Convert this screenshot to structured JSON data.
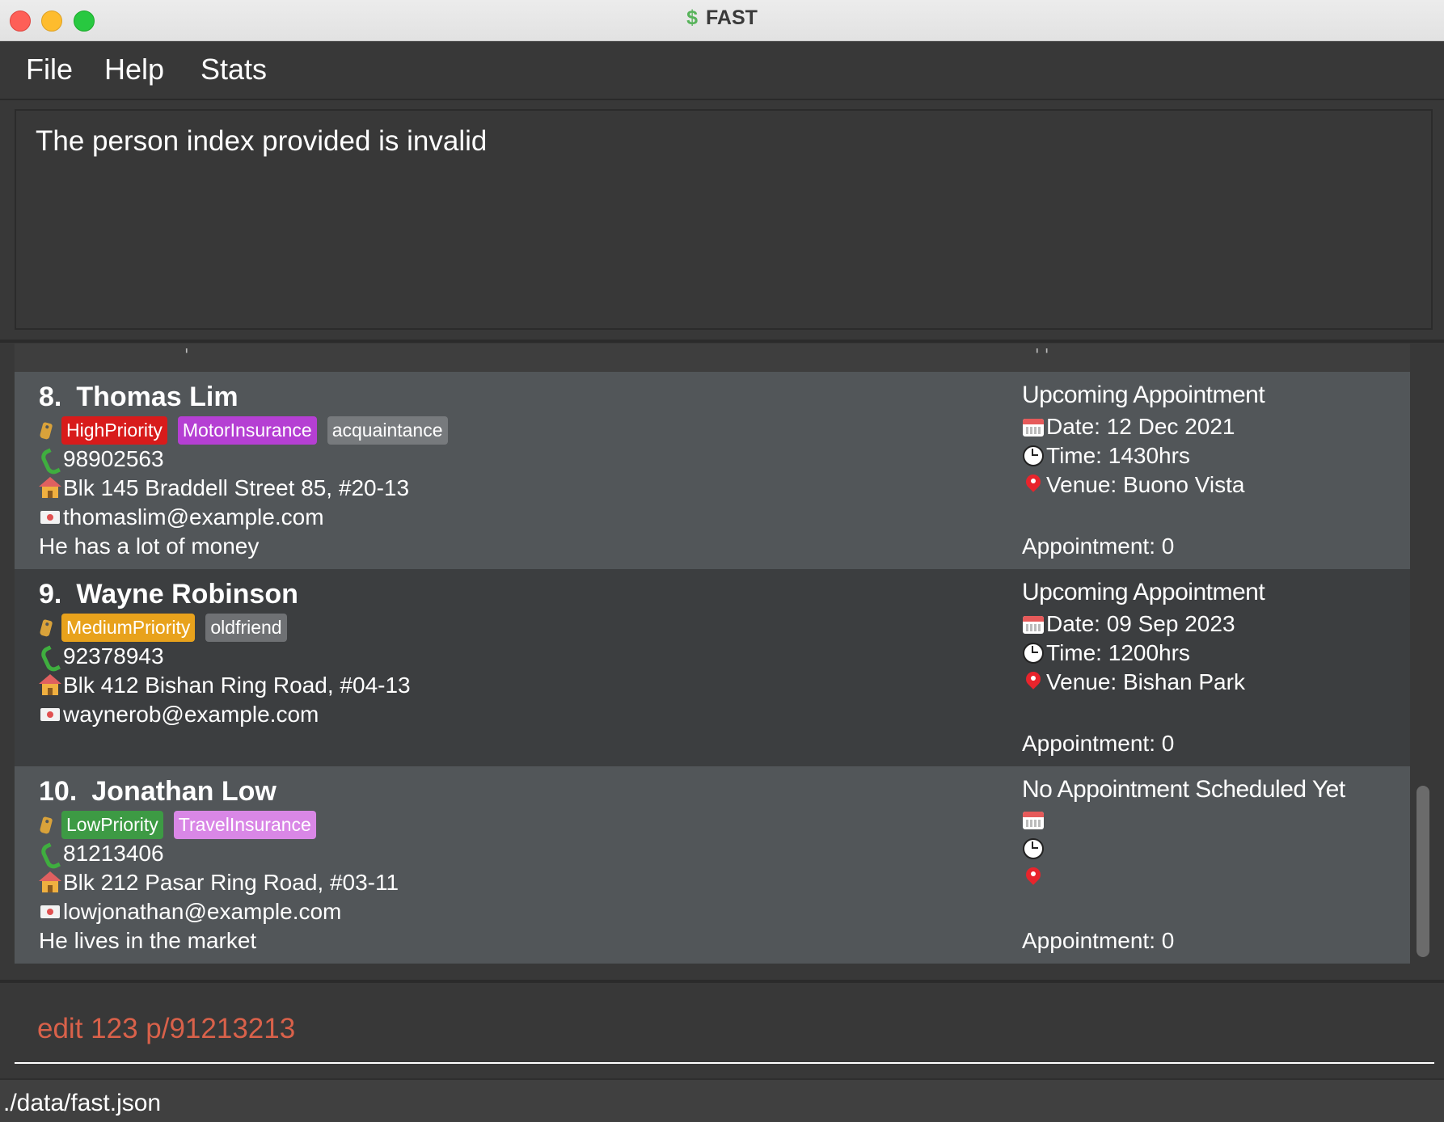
{
  "window": {
    "title": "FAST",
    "icon": "dollar-icon",
    "icon_glyph": "$"
  },
  "menu": {
    "file": "File",
    "help": "Help",
    "stats": "Stats"
  },
  "result": {
    "message": "The person index provided is invalid"
  },
  "persons": [
    {
      "index": "8.",
      "name": "Thomas Lim",
      "tags": [
        {
          "label": "HighPriority",
          "color": "#d81b1b"
        },
        {
          "label": "MotorInsurance",
          "color": "#b53fd3"
        },
        {
          "label": "acquaintance",
          "color": "#777a7d"
        }
      ],
      "phone": "98902563",
      "address": "Blk 145 Braddell Street 85, #20-13",
      "email": "thomaslim@example.com",
      "remark": "He has a lot of money",
      "appointment": {
        "heading": "Upcoming Appointment",
        "date": "Date: 12 Dec 2021",
        "time": "Time: 1430hrs",
        "venue": "Venue: Buono Vista",
        "count": "Appointment: 0"
      }
    },
    {
      "index": "9.",
      "name": "Wayne Robinson",
      "tags": [
        {
          "label": "MediumPriority",
          "color": "#e8a21c"
        },
        {
          "label": "oldfriend",
          "color": "#6f7174"
        }
      ],
      "phone": "92378943",
      "address": "Blk 412 Bishan Ring Road, #04-13",
      "email": "waynerob@example.com",
      "remark": "",
      "appointment": {
        "heading": "Upcoming Appointment",
        "date": "Date: 09 Sep 2023",
        "time": "Time: 1200hrs",
        "venue": "Venue: Bishan Park",
        "count": "Appointment: 0"
      }
    },
    {
      "index": "10.",
      "name": "Jonathan Low",
      "tags": [
        {
          "label": "LowPriority",
          "color": "#3d9a44"
        },
        {
          "label": "TravelInsurance",
          "color": "#d987e6"
        }
      ],
      "phone": "81213406",
      "address": "Blk 212 Pasar Ring Road, #03-11",
      "email": "lowjonathan@example.com",
      "remark": "He lives in the market",
      "appointment": {
        "heading": "No Appointment Scheduled Yet",
        "date": "",
        "time": "",
        "venue": "",
        "count": "Appointment: 0"
      }
    }
  ],
  "command": {
    "value": "edit 123 p/91213213"
  },
  "status": {
    "path": "./data/fast.json"
  }
}
